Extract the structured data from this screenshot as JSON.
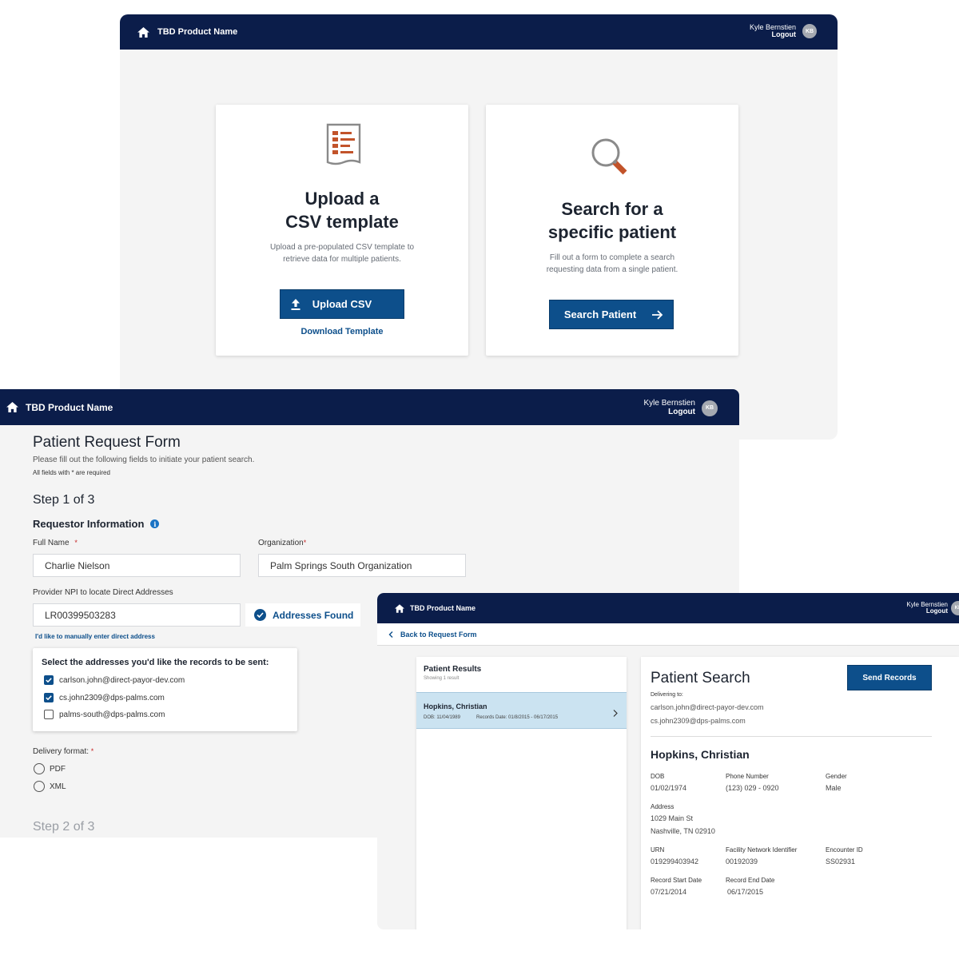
{
  "app": {
    "product_name": "TBD Product Name",
    "user_name": "Kyle Bernstien",
    "logout_label": "Logout",
    "user_initials": "KB"
  },
  "home": {
    "upload_card": {
      "title_line1": "Upload a",
      "title_line2": "CSV template",
      "desc_line1": "Upload a pre-populated CSV template to",
      "desc_line2": "retrieve data for multiple patients.",
      "button_label": "Upload CSV",
      "link_label": "Download Template"
    },
    "search_card": {
      "title_line1": "Search for a",
      "title_line2": "specific patient",
      "desc_line1": "Fill out a form to complete a search",
      "desc_line2": "requesting data from a single patient.",
      "button_label": "Search Patient"
    }
  },
  "form": {
    "title": "Patient Request Form",
    "subtitle": "Please fill out the following fields to initiate your patient search.",
    "required_note": "All fields with * are required",
    "step1": "Step 1 of 3",
    "section_title": "Requestor Information",
    "full_name_label": "Full Name",
    "full_name_value": "Charlie Nielson",
    "organization_label": "Organization",
    "organization_value": "Palm Springs South Organization",
    "npi_label": "Provider NPI to locate Direct Addresses",
    "npi_value": "LR00399503283",
    "addresses_found": "Addresses Found",
    "manual_link": "I'd like to manually enter direct address",
    "address_box_title": "Select the addresses you'd like the records to be sent:",
    "addresses": [
      {
        "email": "carlson.john@direct-payor-dev.com",
        "checked": true
      },
      {
        "email": "cs.john2309@dps-palms.com",
        "checked": true
      },
      {
        "email": "palms-south@dps-palms.com",
        "checked": false
      }
    ],
    "delivery_label": "Delivery format:",
    "formats": [
      "PDF",
      "XML"
    ],
    "step2": "Step 2 of 3"
  },
  "results": {
    "back_link": "Back to Request Form",
    "panel_title": "Patient Results",
    "showing": "Showing 1 result",
    "item_name": "Hopkins, Christian",
    "item_dob": "DOB: 11/04/1989",
    "item_records": "Records Date: 01/8/2015 - 06/17/2015",
    "search_title": "Patient Search",
    "send_button": "Send Records",
    "delivering_label": "Delivering to:",
    "delivering": [
      "carlson.john@direct-payor-dev.com",
      "cs.john2309@dps-palms.com"
    ],
    "patient_name": "Hopkins, Christian",
    "fields": {
      "dob_label": "DOB",
      "dob": "01/02/1974",
      "phone_label": "Phone Number",
      "phone": "(123) 029 - 0920",
      "gender_label": "Gender",
      "gender": "Male",
      "address_label": "Address",
      "address_line1": "1029 Main St",
      "address_line2": "Nashville, TN 02910",
      "urn_label": "URN",
      "urn": "019299403942",
      "facility_label": "Facility Network Identifier",
      "facility": "00192039",
      "encounter_label": "Encounter ID",
      "encounter": "SS02931",
      "start_label": "Record Start Date",
      "start": "07/21/2014",
      "end_label": "Record End Date",
      "end": "06/17/2015"
    }
  },
  "colors": {
    "navy": "#0b1d4a",
    "primary": "#0d4f8b",
    "accent_orange": "#c2532a",
    "selected_row": "#cbe3f1"
  }
}
